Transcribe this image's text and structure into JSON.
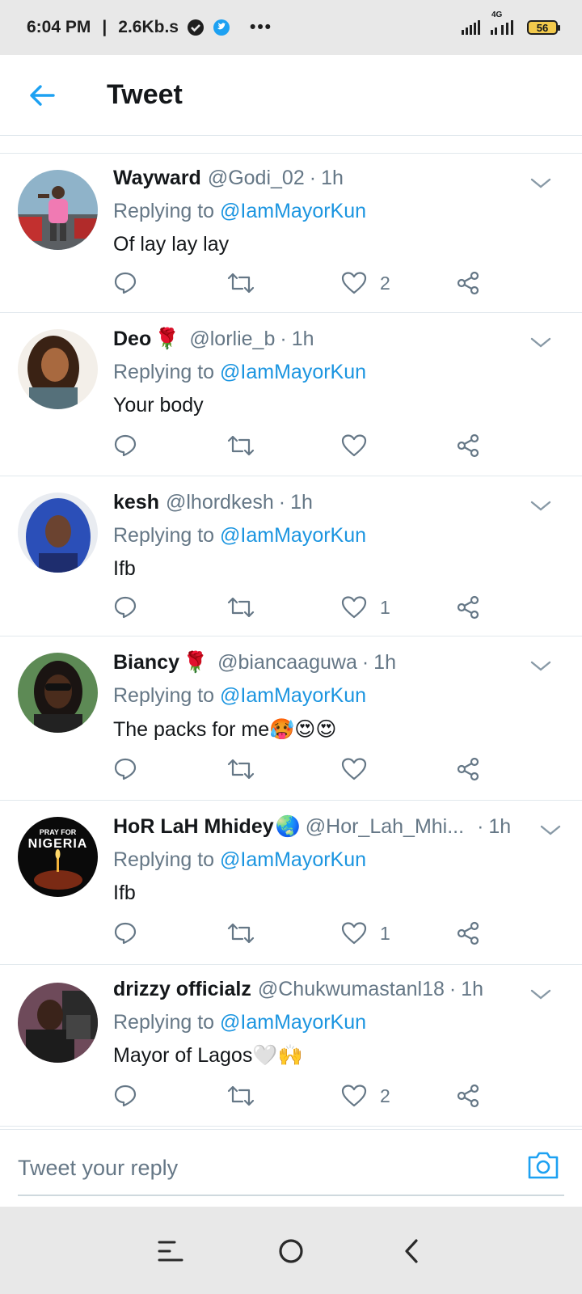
{
  "status_bar": {
    "time": "6:04 PM",
    "separator": "|",
    "speed": "2.6Kb.s",
    "more": "•••",
    "network_label": "4G",
    "battery": "56"
  },
  "header": {
    "title": "Tweet"
  },
  "tweets": [
    {
      "name": "Wayward",
      "handle": "@Godi_02",
      "time": "1h",
      "replying_prefix": "Replying to ",
      "replying_to": "@IamMayorKun",
      "text": "Of lay lay lay",
      "like_count": "2"
    },
    {
      "name": "Deo",
      "name_emoji": "🌹",
      "handle": "@lorlie_b",
      "time": "1h",
      "replying_prefix": "Replying to ",
      "replying_to": "@IamMayorKun",
      "text": "Your body",
      "like_count": ""
    },
    {
      "name": "kesh",
      "handle": "@lhordkesh",
      "time": "1h",
      "replying_prefix": "Replying to ",
      "replying_to": "@IamMayorKun",
      "text": "Ifb",
      "like_count": "1"
    },
    {
      "name": "Biancy",
      "name_emoji": "🌹",
      "handle": "@biancaaguwa",
      "time": "1h",
      "replying_prefix": "Replying to ",
      "replying_to": "@IamMayorKun",
      "text": "The packs for me",
      "text_emojis": "🥵😍😍",
      "like_count": ""
    },
    {
      "name": "HoR LaH Mhidey",
      "name_emoji": "🌏",
      "handle": "@Hor_Lah_Mhi...",
      "time": "1h",
      "replying_prefix": "Replying to ",
      "replying_to": "@IamMayorKun",
      "text": "Ifb",
      "like_count": "1",
      "avatar_text_top": "PRAY FOR",
      "avatar_text_main": "NIGERIA"
    },
    {
      "name": "drizzy officialz",
      "handle": "@Chukwumastanl18",
      "time": "1h",
      "replying_prefix": "Replying to ",
      "replying_to": "@IamMayorKun",
      "text": "Mayor of Lagos",
      "text_emojis": "🤍🙌",
      "like_count": "2"
    }
  ],
  "reply_bar": {
    "placeholder": "Tweet your reply"
  },
  "colors": {
    "accent": "#1b95e0",
    "text": "#14171a",
    "muted": "#657786",
    "divider": "#e1e8ed",
    "system_bar": "#e8e8e8"
  },
  "icons": [
    "back-arrow-icon",
    "reply-icon",
    "retweet-icon",
    "like-icon",
    "share-icon",
    "chevron-down-icon",
    "camera-icon",
    "menu-icon",
    "home-circle-icon",
    "back-chevron-icon"
  ]
}
